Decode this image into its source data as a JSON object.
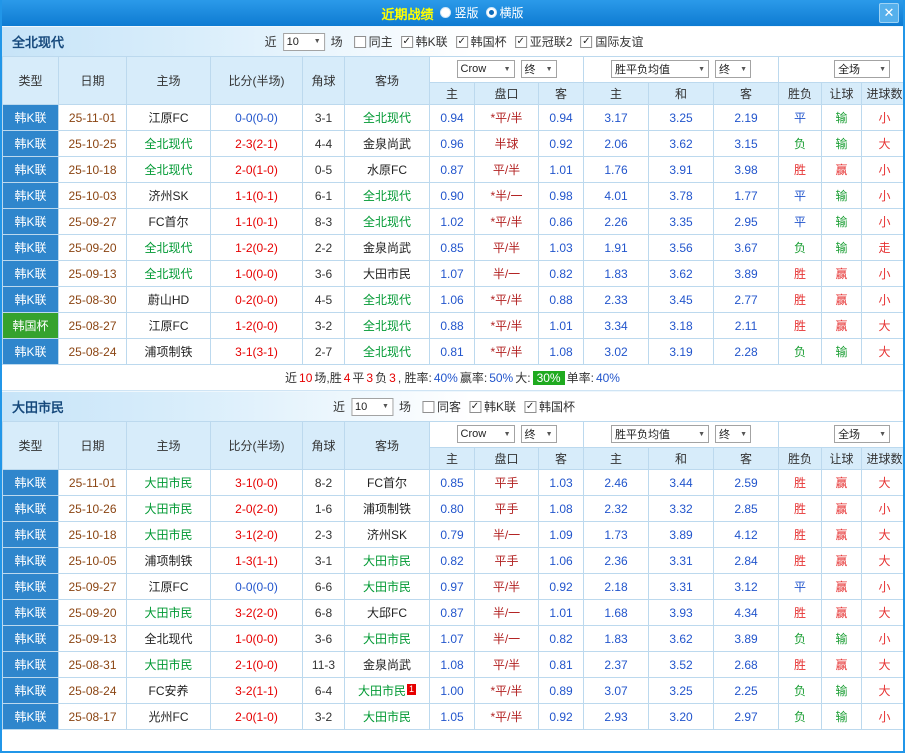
{
  "topbar": {
    "title": "近期战绩",
    "layout_options": [
      {
        "label": "竖版",
        "selected": false
      },
      {
        "label": "横版",
        "selected": true
      }
    ],
    "close_label": "✕"
  },
  "filter_labels": {
    "near": "近",
    "games": "场"
  },
  "table_header": {
    "left_cols": [
      "类型",
      "日期",
      "主场",
      "比分(半场)",
      "角球",
      "客场"
    ],
    "odds_group": {
      "selects": [
        "Crow",
        "终"
      ],
      "cols": [
        "主",
        "盘口",
        "客"
      ]
    },
    "avg_group": {
      "selects": [
        "胜平负均值",
        "终"
      ],
      "cols": [
        "主",
        "和",
        "客"
      ]
    },
    "fullmatch_group": {
      "selects": [
        "全场"
      ],
      "cols": [
        "胜负",
        "让球",
        "进球数"
      ]
    }
  },
  "colors": {
    "topbar_bg": "#1187dd",
    "title_text": "#ffff00",
    "league_colors": {
      "韩K联": "#2f86cc",
      "韩国杯": "#35a22e"
    },
    "focus_team": "#009933",
    "other_team": "#222222",
    "date_text": "#8b4513",
    "score_red": "#e60000",
    "score_blue": "#2255cc",
    "odds_blue": "#2255cc",
    "handicap_red": "#b22222",
    "win_red": "#e63333",
    "draw_blue": "#2255cc",
    "lose_green": "#1a9e33",
    "summary_badge_green": "#1faa1f"
  },
  "sections": [
    {
      "team": "全北现代",
      "filter": {
        "count": "10",
        "checkboxes": [
          {
            "label": "同主",
            "checked": false
          },
          {
            "label": "韩K联",
            "checked": true
          },
          {
            "label": "韩国杯",
            "checked": true
          },
          {
            "label": "亚冠联2",
            "checked": true
          },
          {
            "label": "国际友谊",
            "checked": true
          }
        ]
      },
      "rows": [
        {
          "league": "韩K联",
          "date": "25-11-01",
          "home": "江原FC",
          "home_focus": false,
          "score": "0-0(0-0)",
          "score_blue": true,
          "corners": "3-1",
          "away": "全北现代",
          "away_focus": true,
          "odds": [
            "0.94",
            "*平/半",
            "0.94"
          ],
          "avg": [
            "3.17",
            "3.25",
            "2.19"
          ],
          "result": "平",
          "handicap_result": "输",
          "goals": "小"
        },
        {
          "league": "韩K联",
          "date": "25-10-25",
          "home": "全北现代",
          "home_focus": true,
          "score": "2-3(2-1)",
          "score_blue": false,
          "corners": "4-4",
          "away": "金泉尚武",
          "away_focus": false,
          "odds": [
            "0.96",
            "半球",
            "0.92"
          ],
          "avg": [
            "2.06",
            "3.62",
            "3.15"
          ],
          "result": "负",
          "handicap_result": "输",
          "goals": "大"
        },
        {
          "league": "韩K联",
          "date": "25-10-18",
          "home": "全北现代",
          "home_focus": true,
          "score": "2-0(1-0)",
          "score_blue": false,
          "corners": "0-5",
          "away": "水原FC",
          "away_focus": false,
          "odds": [
            "0.87",
            "平/半",
            "1.01"
          ],
          "avg": [
            "1.76",
            "3.91",
            "3.98"
          ],
          "result": "胜",
          "handicap_result": "赢",
          "goals": "小"
        },
        {
          "league": "韩K联",
          "date": "25-10-03",
          "home": "济州SK",
          "home_focus": false,
          "score": "1-1(0-1)",
          "score_blue": false,
          "corners": "6-1",
          "away": "全北现代",
          "away_focus": true,
          "odds": [
            "0.90",
            "*半/一",
            "0.98"
          ],
          "avg": [
            "4.01",
            "3.78",
            "1.77"
          ],
          "result": "平",
          "handicap_result": "输",
          "goals": "小"
        },
        {
          "league": "韩K联",
          "date": "25-09-27",
          "home": "FC首尔",
          "home_focus": false,
          "score": "1-1(0-1)",
          "score_blue": false,
          "corners": "8-3",
          "away": "全北现代",
          "away_focus": true,
          "odds": [
            "1.02",
            "*平/半",
            "0.86"
          ],
          "avg": [
            "2.26",
            "3.35",
            "2.95"
          ],
          "result": "平",
          "handicap_result": "输",
          "goals": "小"
        },
        {
          "league": "韩K联",
          "date": "25-09-20",
          "home": "全北现代",
          "home_focus": true,
          "score": "1-2(0-2)",
          "score_blue": false,
          "corners": "2-2",
          "away": "金泉尚武",
          "away_focus": false,
          "odds": [
            "0.85",
            "平/半",
            "1.03"
          ],
          "avg": [
            "1.91",
            "3.56",
            "3.67"
          ],
          "result": "负",
          "handicap_result": "输",
          "goals": "走"
        },
        {
          "league": "韩K联",
          "date": "25-09-13",
          "home": "全北现代",
          "home_focus": true,
          "score": "1-0(0-0)",
          "score_blue": false,
          "corners": "3-6",
          "away": "大田市民",
          "away_focus": false,
          "odds": [
            "1.07",
            "半/一",
            "0.82"
          ],
          "avg": [
            "1.83",
            "3.62",
            "3.89"
          ],
          "result": "胜",
          "handicap_result": "赢",
          "goals": "小"
        },
        {
          "league": "韩K联",
          "date": "25-08-30",
          "home": "蔚山HD",
          "home_focus": false,
          "score": "0-2(0-0)",
          "score_blue": false,
          "corners": "4-5",
          "away": "全北现代",
          "away_focus": true,
          "odds": [
            "1.06",
            "*平/半",
            "0.88"
          ],
          "avg": [
            "2.33",
            "3.45",
            "2.77"
          ],
          "result": "胜",
          "handicap_result": "赢",
          "goals": "小"
        },
        {
          "league": "韩国杯",
          "date": "25-08-27",
          "home": "江原FC",
          "home_focus": false,
          "score": "1-2(0-0)",
          "score_blue": false,
          "corners": "3-2",
          "away": "全北现代",
          "away_focus": true,
          "odds": [
            "0.88",
            "*平/半",
            "1.01"
          ],
          "avg": [
            "3.34",
            "3.18",
            "2.11"
          ],
          "result": "胜",
          "handicap_result": "赢",
          "goals": "大"
        },
        {
          "league": "韩K联",
          "date": "25-08-24",
          "home": "浦项制铁",
          "home_focus": false,
          "score": "3-1(3-1)",
          "score_blue": false,
          "corners": "2-7",
          "away": "全北现代",
          "away_focus": true,
          "odds": [
            "0.81",
            "*平/半",
            "1.08"
          ],
          "avg": [
            "3.02",
            "3.19",
            "2.28"
          ],
          "result": "负",
          "handicap_result": "输",
          "goals": "大"
        }
      ],
      "summary_segments": [
        {
          "text": "近",
          "color": "#333333"
        },
        {
          "text": "10",
          "color": "#e60000"
        },
        {
          "text": "场,胜",
          "color": "#333333"
        },
        {
          "text": "4",
          "color": "#e60000"
        },
        {
          "text": "平",
          "color": "#333333"
        },
        {
          "text": "3",
          "color": "#e60000"
        },
        {
          "text": "负",
          "color": "#333333"
        },
        {
          "text": "3",
          "color": "#e60000"
        },
        {
          "text": ", 胜率:",
          "color": "#333333"
        },
        {
          "text": "40%",
          "color": "#2255cc"
        },
        {
          "text": " 赢率:",
          "color": "#333333"
        },
        {
          "text": "50%",
          "color": "#2255cc"
        },
        {
          "text": " 大:",
          "color": "#333333"
        },
        {
          "text": "30%",
          "color": "#ffffff",
          "bg": "#1faa1f"
        },
        {
          "text": " 单率:",
          "color": "#333333"
        },
        {
          "text": "40%",
          "color": "#2255cc"
        }
      ]
    },
    {
      "team": "大田市民",
      "filter": {
        "count": "10",
        "checkboxes": [
          {
            "label": "同客",
            "checked": false
          },
          {
            "label": "韩K联",
            "checked": true
          },
          {
            "label": "韩国杯",
            "checked": true
          }
        ]
      },
      "rows": [
        {
          "league": "韩K联",
          "date": "25-11-01",
          "home": "大田市民",
          "home_focus": true,
          "score": "3-1(0-0)",
          "score_blue": false,
          "corners": "8-2",
          "away": "FC首尔",
          "away_focus": false,
          "odds": [
            "0.85",
            "平手",
            "1.03"
          ],
          "avg": [
            "2.46",
            "3.44",
            "2.59"
          ],
          "result": "胜",
          "handicap_result": "赢",
          "goals": "大"
        },
        {
          "league": "韩K联",
          "date": "25-10-26",
          "home": "大田市民",
          "home_focus": true,
          "score": "2-0(2-0)",
          "score_blue": false,
          "corners": "1-6",
          "away": "浦项制铁",
          "away_focus": false,
          "odds": [
            "0.80",
            "平手",
            "1.08"
          ],
          "avg": [
            "2.32",
            "3.32",
            "2.85"
          ],
          "result": "胜",
          "handicap_result": "赢",
          "goals": "小"
        },
        {
          "league": "韩K联",
          "date": "25-10-18",
          "home": "大田市民",
          "home_focus": true,
          "score": "3-1(2-0)",
          "score_blue": false,
          "corners": "2-3",
          "away": "济州SK",
          "away_focus": false,
          "odds": [
            "0.79",
            "半/一",
            "1.09"
          ],
          "avg": [
            "1.73",
            "3.89",
            "4.12"
          ],
          "result": "胜",
          "handicap_result": "赢",
          "goals": "大"
        },
        {
          "league": "韩K联",
          "date": "25-10-05",
          "home": "浦项制铁",
          "home_focus": false,
          "score": "1-3(1-1)",
          "score_blue": false,
          "corners": "3-1",
          "away": "大田市民",
          "away_focus": true,
          "odds": [
            "0.82",
            "平手",
            "1.06"
          ],
          "avg": [
            "2.36",
            "3.31",
            "2.84"
          ],
          "result": "胜",
          "handicap_result": "赢",
          "goals": "大"
        },
        {
          "league": "韩K联",
          "date": "25-09-27",
          "home": "江原FC",
          "home_focus": false,
          "score": "0-0(0-0)",
          "score_blue": true,
          "corners": "6-6",
          "away": "大田市民",
          "away_focus": true,
          "odds": [
            "0.97",
            "平/半",
            "0.92"
          ],
          "avg": [
            "2.18",
            "3.31",
            "3.12"
          ],
          "result": "平",
          "handicap_result": "赢",
          "goals": "小"
        },
        {
          "league": "韩K联",
          "date": "25-09-20",
          "home": "大田市民",
          "home_focus": true,
          "score": "3-2(2-0)",
          "score_blue": false,
          "corners": "6-8",
          "away": "大邱FC",
          "away_focus": false,
          "odds": [
            "0.87",
            "半/一",
            "1.01"
          ],
          "avg": [
            "1.68",
            "3.93",
            "4.34"
          ],
          "result": "胜",
          "handicap_result": "赢",
          "goals": "大"
        },
        {
          "league": "韩K联",
          "date": "25-09-13",
          "home": "全北现代",
          "home_focus": false,
          "score": "1-0(0-0)",
          "score_blue": false,
          "corners": "3-6",
          "away": "大田市民",
          "away_focus": true,
          "odds": [
            "1.07",
            "半/一",
            "0.82"
          ],
          "avg": [
            "1.83",
            "3.62",
            "3.89"
          ],
          "result": "负",
          "handicap_result": "输",
          "goals": "小"
        },
        {
          "league": "韩K联",
          "date": "25-08-31",
          "home": "大田市民",
          "home_focus": true,
          "score": "2-1(0-0)",
          "score_blue": false,
          "corners": "11-3",
          "away": "金泉尚武",
          "away_focus": false,
          "odds": [
            "1.08",
            "平/半",
            "0.81"
          ],
          "avg": [
            "2.37",
            "3.52",
            "2.68"
          ],
          "result": "胜",
          "handicap_result": "赢",
          "goals": "大"
        },
        {
          "league": "韩K联",
          "date": "25-08-24",
          "home": "FC安养",
          "home_focus": false,
          "score": "3-2(1-1)",
          "score_blue": false,
          "corners": "6-4",
          "away": "大田市民",
          "away_focus": true,
          "away_badge": "1",
          "odds": [
            "1.00",
            "*平/半",
            "0.89"
          ],
          "avg": [
            "3.07",
            "3.25",
            "2.25"
          ],
          "result": "负",
          "handicap_result": "输",
          "goals": "大"
        },
        {
          "league": "韩K联",
          "date": "25-08-17",
          "home": "光州FC",
          "home_focus": false,
          "score": "2-0(1-0)",
          "score_blue": false,
          "corners": "3-2",
          "away": "大田市民",
          "away_focus": true,
          "odds": [
            "1.05",
            "*平/半",
            "0.92"
          ],
          "avg": [
            "2.93",
            "3.20",
            "2.97"
          ],
          "result": "负",
          "handicap_result": "输",
          "goals": "小"
        }
      ]
    }
  ]
}
